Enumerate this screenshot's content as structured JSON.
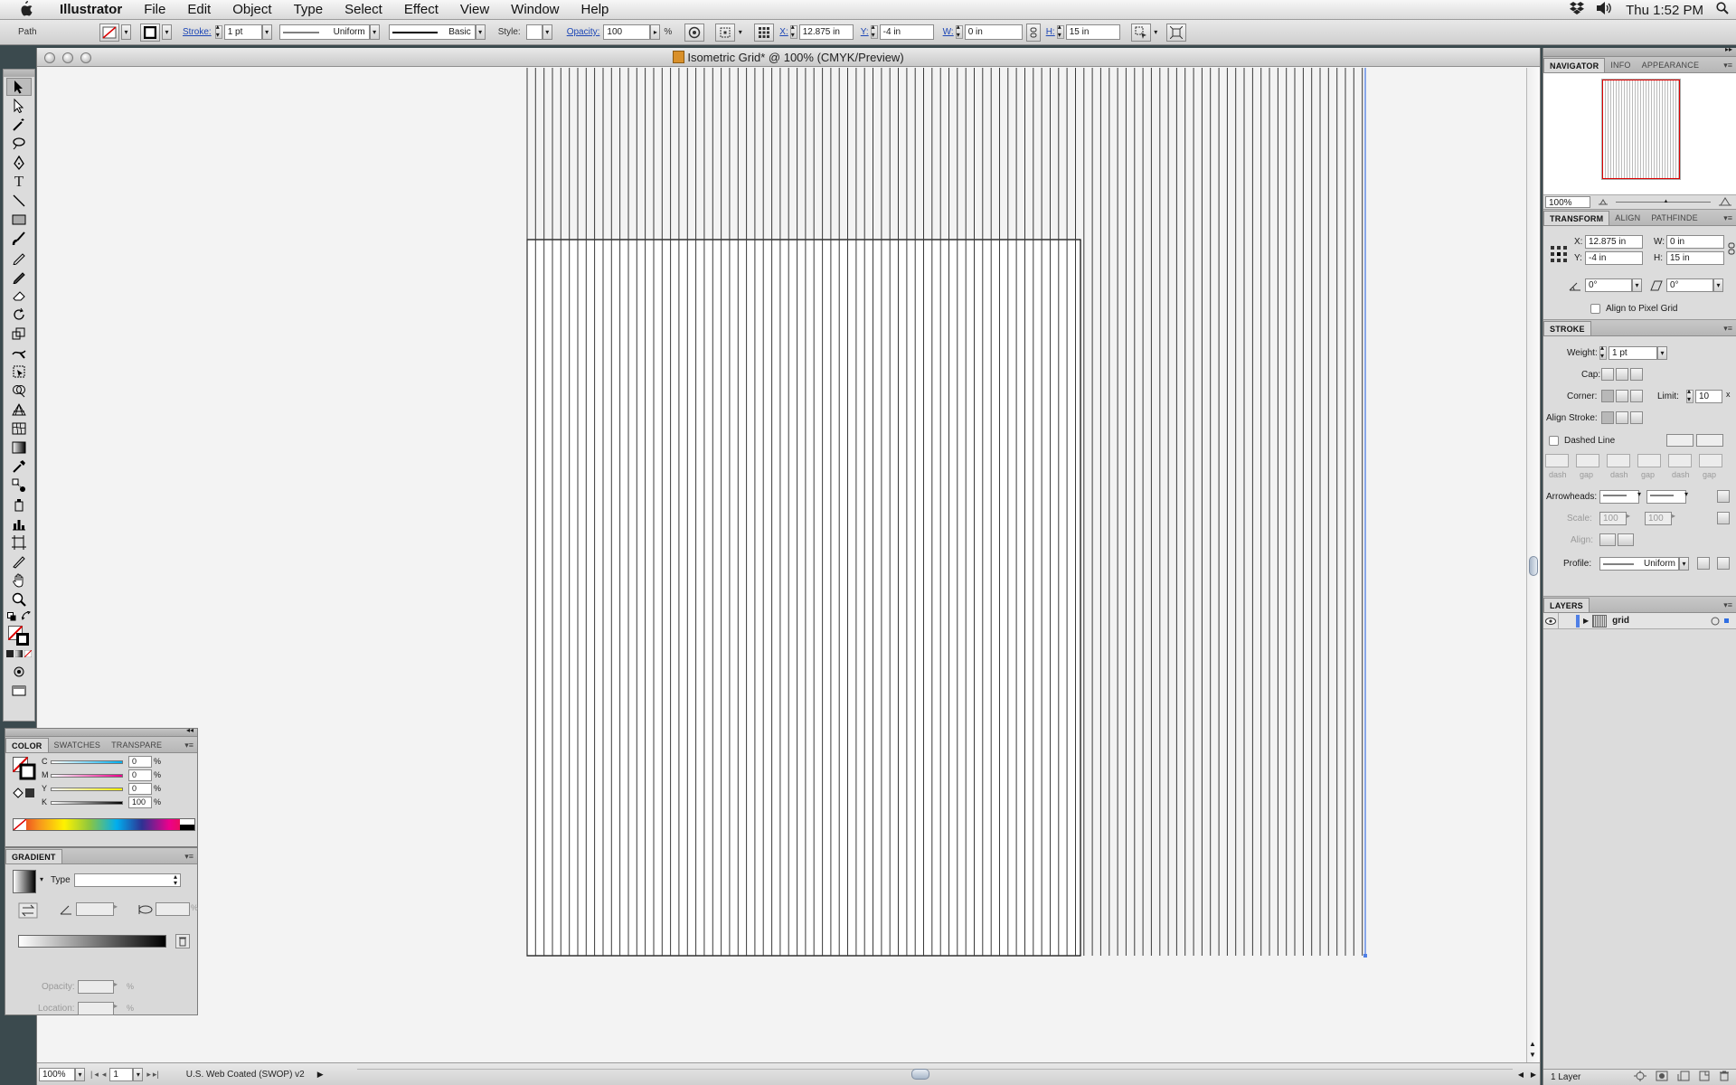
{
  "menubar": {
    "app": "Illustrator",
    "items": [
      "File",
      "Edit",
      "Object",
      "Type",
      "Select",
      "Effect",
      "View",
      "Window",
      "Help"
    ],
    "clock": "Thu 1:52 PM"
  },
  "control": {
    "selection_type": "Path",
    "stroke_label": "Stroke:",
    "stroke_weight": "1 pt",
    "profile": "Uniform",
    "brush": "Basic",
    "style_label": "Style:",
    "opacity_label": "Opacity:",
    "opacity_value": "100",
    "percent": "%",
    "x_label": "X:",
    "x_value": "12.875 in",
    "y_label": "Y:",
    "y_value": "-4 in",
    "w_label": "W:",
    "w_value": "0 in",
    "h_label": "H:",
    "h_value": "15 in"
  },
  "document": {
    "title": "Isometric Grid* @ 100% (CMYK/Preview)",
    "zoom": "100%",
    "artboard": "1",
    "profile": "U.S. Web Coated (SWOP) v2"
  },
  "color_panel": {
    "tabs": [
      "COLOR",
      "SWATCHES",
      "TRANSPARE"
    ],
    "channels": [
      {
        "label": "C",
        "value": "0",
        "color": "#00aeef"
      },
      {
        "label": "M",
        "value": "0",
        "color": "#ec008c"
      },
      {
        "label": "Y",
        "value": "0",
        "color": "#fff200"
      },
      {
        "label": "K",
        "value": "100",
        "color": "#000000"
      }
    ],
    "percent": "%"
  },
  "gradient_panel": {
    "title": "GRADIENT",
    "type_label": "Type",
    "opacity_label": "Opacity:",
    "location_label": "Location:",
    "percent": "%"
  },
  "navigator": {
    "tabs": [
      "NAVIGATOR",
      "INFO",
      "APPEARANCE"
    ],
    "zoom": "100%"
  },
  "transform": {
    "tabs": [
      "TRANSFORM",
      "ALIGN",
      "PATHFINDE"
    ],
    "x_label": "X:",
    "x_value": "12.875 in",
    "y_label": "Y:",
    "y_value": "-4 in",
    "w_label": "W:",
    "w_value": "0 in",
    "h_label": "H:",
    "h_value": "15 in",
    "angle": "0°",
    "shear": "0°",
    "align_pixel": "Align to Pixel Grid"
  },
  "stroke_panel": {
    "title": "STROKE",
    "weight_label": "Weight:",
    "weight_value": "1 pt",
    "cap_label": "Cap:",
    "corner_label": "Corner:",
    "limit_label": "Limit:",
    "limit_value": "10",
    "limit_x": "x",
    "align_label": "Align Stroke:",
    "dashed_label": "Dashed Line",
    "dash_labels": [
      "dash",
      "gap",
      "dash",
      "gap",
      "dash",
      "gap"
    ],
    "arrowheads_label": "Arrowheads:",
    "scale_label": "Scale:",
    "scale_1": "100",
    "scale_2": "100",
    "align_arrows_label": "Align:",
    "profile_label": "Profile:",
    "profile_value": "Uniform"
  },
  "layers_panel": {
    "title": "LAYERS",
    "layers": [
      {
        "name": "grid"
      }
    ],
    "count": "1 Layer"
  }
}
